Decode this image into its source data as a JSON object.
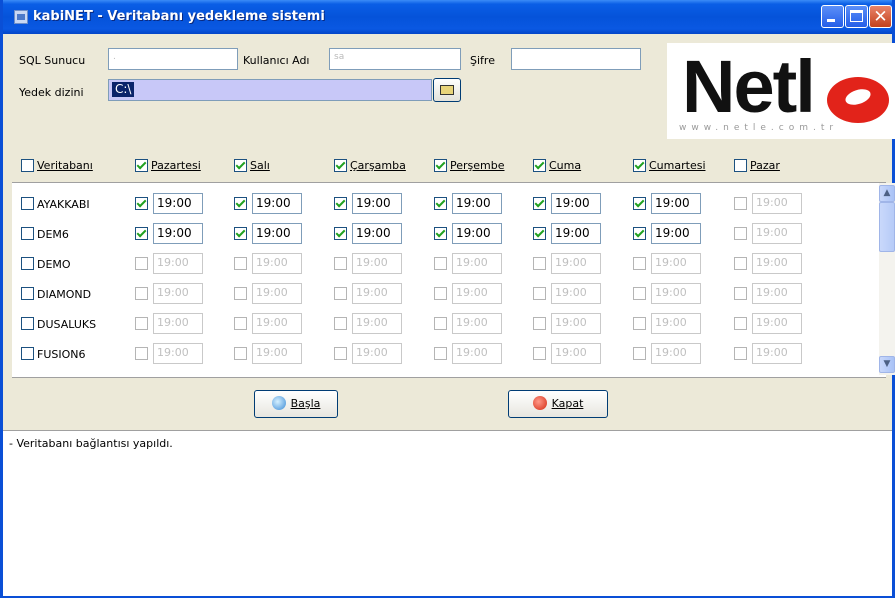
{
  "window": {
    "title": "kabiNET - Veritabanı yedekleme sistemi"
  },
  "connection": {
    "server_label": "SQL Sunucu",
    "server_value": ".",
    "user_label": "Kullanıcı Adı",
    "user_value": "sa",
    "password_label": "Şifre",
    "password_value": "",
    "backup_dir_label": "Yedek dizini",
    "backup_dir_value": "C:\\"
  },
  "logo": {
    "text": "Netl",
    "url": "www.netle.com.tr"
  },
  "columns": [
    {
      "label": "Veritabanı",
      "checked": false
    },
    {
      "label": "Pazartesi",
      "checked": true
    },
    {
      "label": "Salı",
      "checked": true
    },
    {
      "label": "Çarşamba",
      "checked": true
    },
    {
      "label": "Perşembe",
      "checked": true
    },
    {
      "label": "Cuma",
      "checked": true
    },
    {
      "label": "Cumartesi",
      "checked": true
    },
    {
      "label": "Pazar",
      "checked": false
    }
  ],
  "rows": [
    {
      "name": "AYAKKABI",
      "days": [
        {
          "checked": true,
          "time": "19:00"
        },
        {
          "checked": true,
          "time": "19:00"
        },
        {
          "checked": true,
          "time": "19:00"
        },
        {
          "checked": true,
          "time": "19:00"
        },
        {
          "checked": true,
          "time": "19:00"
        },
        {
          "checked": true,
          "time": "19:00"
        },
        {
          "checked": false,
          "time": "19:00"
        }
      ]
    },
    {
      "name": "DEM6",
      "days": [
        {
          "checked": true,
          "time": "19:00"
        },
        {
          "checked": true,
          "time": "19:00"
        },
        {
          "checked": true,
          "time": "19:00"
        },
        {
          "checked": true,
          "time": "19:00"
        },
        {
          "checked": true,
          "time": "19:00"
        },
        {
          "checked": true,
          "time": "19:00"
        },
        {
          "checked": false,
          "time": "19:00"
        }
      ]
    },
    {
      "name": "DEMO",
      "days": [
        {
          "checked": false,
          "time": "19:00"
        },
        {
          "checked": false,
          "time": "19:00"
        },
        {
          "checked": false,
          "time": "19:00"
        },
        {
          "checked": false,
          "time": "19:00"
        },
        {
          "checked": false,
          "time": "19:00"
        },
        {
          "checked": false,
          "time": "19:00"
        },
        {
          "checked": false,
          "time": "19:00"
        }
      ]
    },
    {
      "name": "DIAMOND",
      "days": [
        {
          "checked": false,
          "time": "19:00"
        },
        {
          "checked": false,
          "time": "19:00"
        },
        {
          "checked": false,
          "time": "19:00"
        },
        {
          "checked": false,
          "time": "19:00"
        },
        {
          "checked": false,
          "time": "19:00"
        },
        {
          "checked": false,
          "time": "19:00"
        },
        {
          "checked": false,
          "time": "19:00"
        }
      ]
    },
    {
      "name": "DUSALUKS",
      "days": [
        {
          "checked": false,
          "time": "19:00"
        },
        {
          "checked": false,
          "time": "19:00"
        },
        {
          "checked": false,
          "time": "19:00"
        },
        {
          "checked": false,
          "time": "19:00"
        },
        {
          "checked": false,
          "time": "19:00"
        },
        {
          "checked": false,
          "time": "19:00"
        },
        {
          "checked": false,
          "time": "19:00"
        }
      ]
    },
    {
      "name": "FUSION6",
      "days": [
        {
          "checked": false,
          "time": "19:00"
        },
        {
          "checked": false,
          "time": "19:00"
        },
        {
          "checked": false,
          "time": "19:00"
        },
        {
          "checked": false,
          "time": "19:00"
        },
        {
          "checked": false,
          "time": "19:00"
        },
        {
          "checked": false,
          "time": "19:00"
        },
        {
          "checked": false,
          "time": "19:00"
        }
      ]
    }
  ],
  "buttons": {
    "start_label": "Başla",
    "close_label": "Kapat"
  },
  "log": {
    "lines": [
      "- Veritabanı bağlantısı yapıldı."
    ]
  },
  "icons": {
    "start": "backup-start-icon",
    "close": "close-red-icon",
    "folder": "folder-open-icon"
  },
  "colors": {
    "title_bar": "#0553da",
    "accent_red": "#e2231a",
    "check_green": "#21a121"
  }
}
